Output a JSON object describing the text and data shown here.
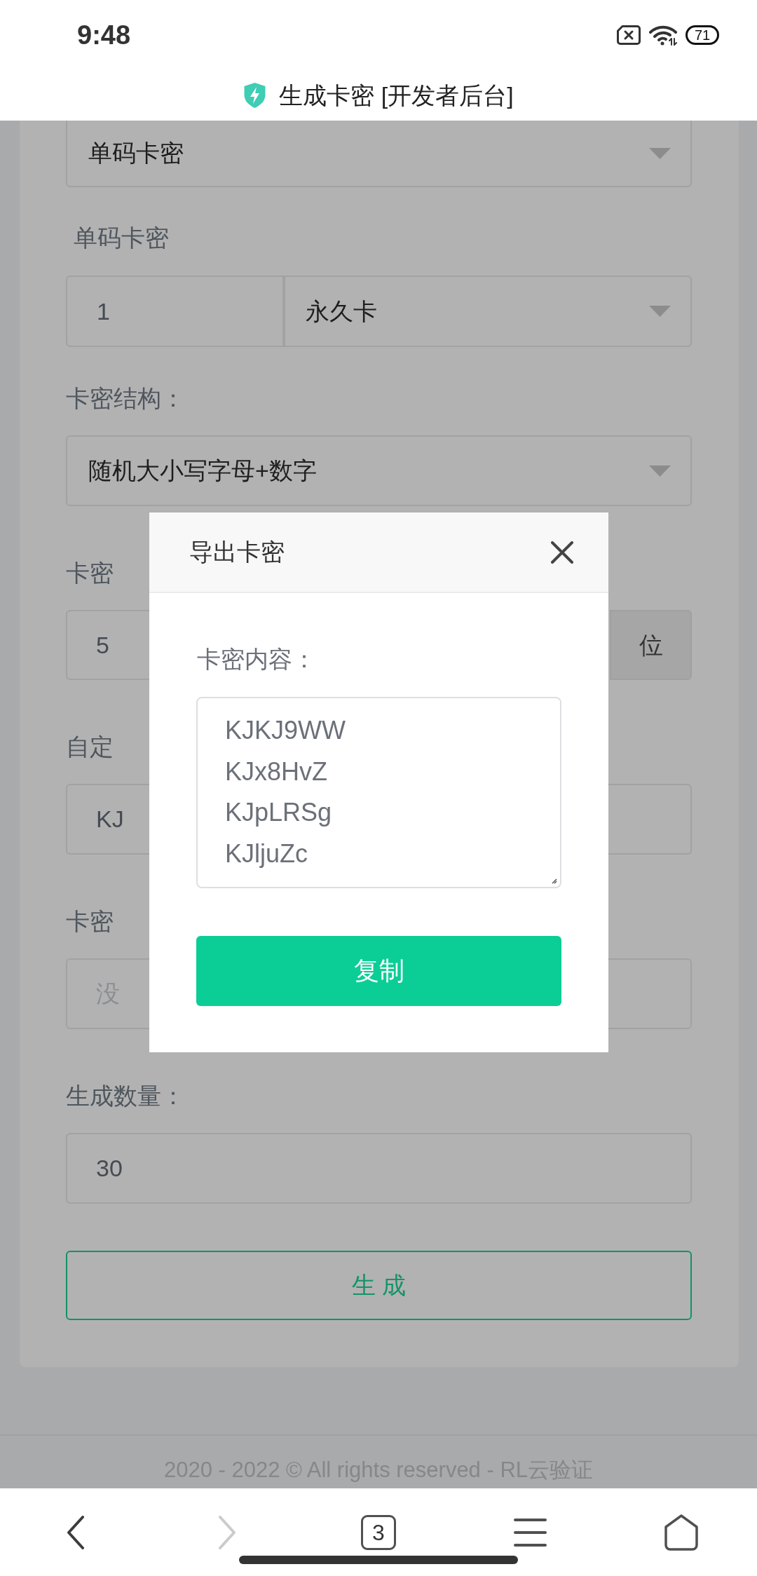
{
  "status_bar": {
    "time": "9:48",
    "battery": "71"
  },
  "title_bar": {
    "title": "生成卡密 [开发者后台]"
  },
  "form": {
    "items": [
      {
        "kind": "select",
        "value": "单码卡密"
      },
      {
        "kind": "label",
        "text": "单码卡密"
      },
      {
        "kind": "input_select",
        "value": "1",
        "option": "永久卡"
      },
      {
        "kind": "label",
        "text": "卡密结构："
      },
      {
        "kind": "select",
        "value": "随机大小写字母+数字"
      },
      {
        "kind": "label",
        "text": "卡密"
      },
      {
        "kind": "input_addon",
        "value": "5",
        "addon": "位"
      },
      {
        "kind": "label",
        "text": "自定"
      },
      {
        "kind": "input",
        "value": "KJ"
      },
      {
        "kind": "label",
        "text": "卡密"
      },
      {
        "kind": "input",
        "placeholder": "没"
      },
      {
        "kind": "label",
        "text": "生成数量："
      },
      {
        "kind": "input",
        "value": "30"
      },
      {
        "kind": "button",
        "label": "生 成"
      }
    ]
  },
  "footer": {
    "text": "2020 - 2022 © All rights reserved - RL云验证"
  },
  "dialog": {
    "title": "导出卡密",
    "field_label": "卡密内容：",
    "codes": [
      "KJKJ9WW",
      "KJx8HvZ",
      "KJpLRSg",
      "KJljuZc"
    ],
    "button": "复制"
  },
  "browser_nav": [
    {
      "kind": "back",
      "disabled": false
    },
    {
      "kind": "forward",
      "disabled": true
    },
    {
      "kind": "tabs",
      "label": "3",
      "disabled": false
    },
    {
      "kind": "menu",
      "disabled": false
    },
    {
      "kind": "home",
      "disabled": false
    }
  ]
}
